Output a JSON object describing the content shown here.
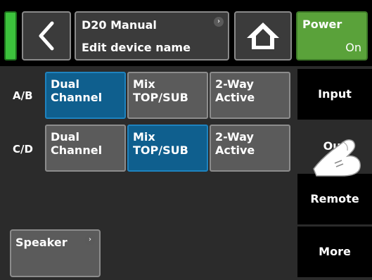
{
  "header": {
    "title_line1": "D20 Manual",
    "title_line2": "Edit device name",
    "info_glyph": "›",
    "power_label": "Power",
    "power_state": "On",
    "back_icon": "chevron-left-icon",
    "home_icon": "home-icon"
  },
  "rows": [
    {
      "label": "A/B",
      "modes": [
        {
          "l1": "Dual",
          "l2": "Channel",
          "selected": true
        },
        {
          "l1": "Mix",
          "l2": "TOP/SUB",
          "selected": false
        },
        {
          "l1": "2-Way",
          "l2": "Active",
          "selected": false
        }
      ]
    },
    {
      "label": "C/D",
      "modes": [
        {
          "l1": "Dual",
          "l2": "Channel",
          "selected": false
        },
        {
          "l1": "Mix",
          "l2": "TOP/SUB",
          "selected": true
        },
        {
          "l1": "2-Way",
          "l2": "Active",
          "selected": false
        }
      ]
    }
  ],
  "side_tabs": {
    "input": "Input",
    "output": "Out",
    "remote": "Remote",
    "more": "More"
  },
  "speaker": {
    "label": "Speaker",
    "info_glyph": "›"
  },
  "colors": {
    "selected": "#0f5f8e",
    "power_on": "#5aa23a",
    "led": "#3cc23c"
  }
}
